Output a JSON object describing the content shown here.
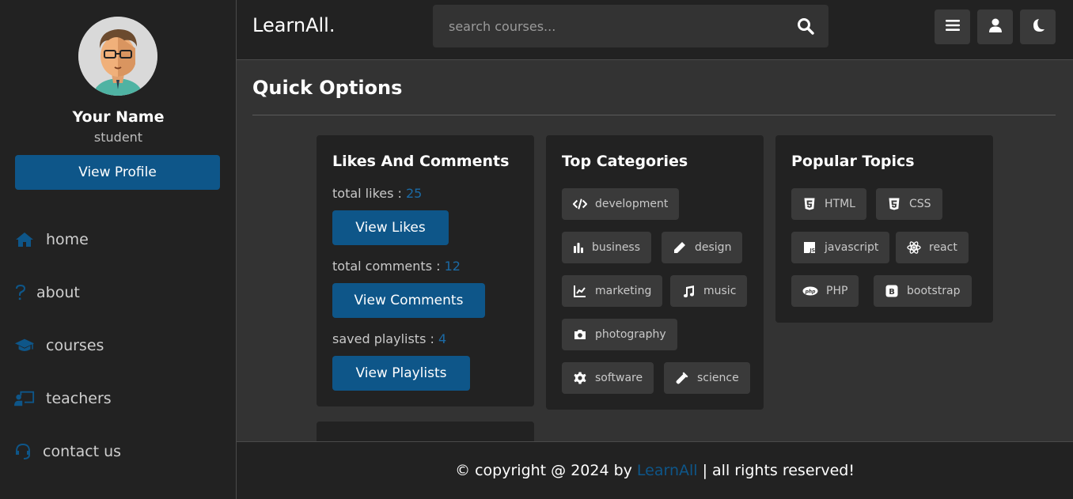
{
  "sidebar": {
    "profile": {
      "name": "Your Name",
      "role": "student",
      "button": "View Profile"
    },
    "nav": [
      {
        "label": "home",
        "icon": "home-icon"
      },
      {
        "label": "about",
        "icon": "question-icon"
      },
      {
        "label": "courses",
        "icon": "graduation-cap-icon"
      },
      {
        "label": "teachers",
        "icon": "chalkboard-teacher-icon"
      },
      {
        "label": "contact us",
        "icon": "headset-icon"
      }
    ]
  },
  "header": {
    "logo": "LearnAll.",
    "search_placeholder": "search courses..."
  },
  "main": {
    "title": "Quick Options",
    "likes_card": {
      "title": "Likes And Comments",
      "likes_label": "total likes : ",
      "likes_value": "25",
      "likes_button": "View Likes",
      "comments_label": "total comments : ",
      "comments_value": "12",
      "comments_button": "View Comments",
      "playlists_label": "saved playlists : ",
      "playlists_value": "4",
      "playlists_button": "View Playlists"
    },
    "categories_card": {
      "title": "Top Categories",
      "tags": [
        "development",
        "business",
        "design",
        "marketing",
        "music",
        "photography",
        "software",
        "science"
      ]
    },
    "topics_card": {
      "title": "Popular Topics",
      "tags": [
        "HTML",
        "CSS",
        "javascript",
        "react",
        "PHP",
        "bootstrap"
      ]
    }
  },
  "footer": {
    "prefix": "© copyright @ 2024 by",
    "brand": "LearnAll",
    "suffix": "| all rights reserved!"
  },
  "colors": {
    "accent": "#0e5689",
    "panel": "#222222",
    "bg": "#333333",
    "tag": "#3a3a3a"
  }
}
